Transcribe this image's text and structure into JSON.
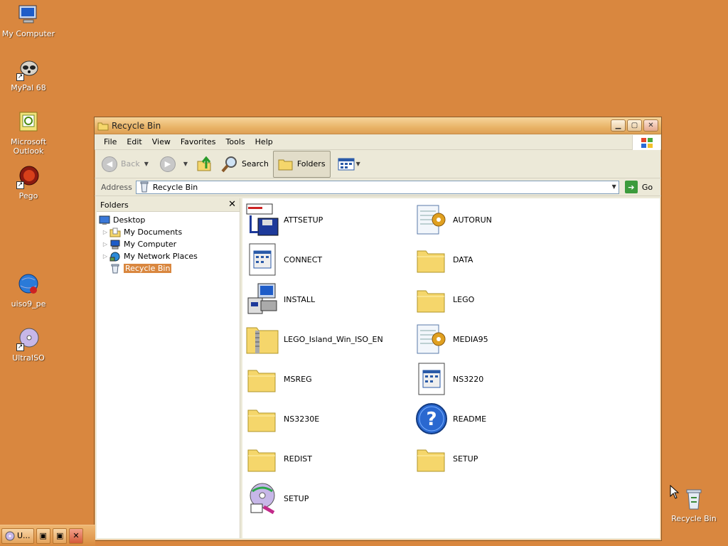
{
  "desktop": {
    "icons": [
      {
        "label": "My Computer",
        "icon": "my-computer-icon"
      },
      {
        "label": "MyPal 68",
        "icon": "raccoon-icon"
      },
      {
        "label": "Microsoft Outlook",
        "icon": "outlook-icon"
      },
      {
        "label": "Pego",
        "icon": "pego-icon"
      },
      {
        "label": "uiso9_pe",
        "icon": "globe-icon"
      },
      {
        "label": "UltraISO",
        "icon": "disc-icon"
      },
      {
        "label": "Recycle Bin",
        "icon": "recycle-bin-icon"
      }
    ]
  },
  "window": {
    "title": "Recycle Bin",
    "menu": [
      "File",
      "Edit",
      "View",
      "Favorites",
      "Tools",
      "Help"
    ],
    "toolbar": {
      "back": "Back",
      "search": "Search",
      "folders": "Folders"
    },
    "address": {
      "label": "Address",
      "value": "Recycle Bin",
      "go": "Go"
    },
    "folders_pane": {
      "header": "Folders",
      "tree": [
        {
          "label": "Desktop",
          "icon": "desktop-icon",
          "indent": 0,
          "expander": false
        },
        {
          "label": "My Documents",
          "icon": "my-documents-icon",
          "indent": 1,
          "expander": true
        },
        {
          "label": "My Computer",
          "icon": "my-computer-icon",
          "indent": 1,
          "expander": true
        },
        {
          "label": "My Network Places",
          "icon": "network-places-icon",
          "indent": 1,
          "expander": true
        },
        {
          "label": "Recycle Bin",
          "icon": "recycle-bin-icon",
          "indent": 1,
          "expander": false,
          "selected": true
        }
      ]
    },
    "files": [
      {
        "name": "ATTSETUP",
        "icon": "setup-floppy-icon"
      },
      {
        "name": "AUTORUN",
        "icon": "config-file-icon"
      },
      {
        "name": "CONNECT",
        "icon": "app-window-icon"
      },
      {
        "name": "DATA",
        "icon": "folder-icon"
      },
      {
        "name": "INSTALL",
        "icon": "installer-icon"
      },
      {
        "name": "LEGO",
        "icon": "folder-icon"
      },
      {
        "name": "LEGO_Island_Win_ISO_EN",
        "icon": "zip-folder-icon"
      },
      {
        "name": "MEDIA95",
        "icon": "config-file-icon"
      },
      {
        "name": "MSREG",
        "icon": "folder-icon"
      },
      {
        "name": "NS3220",
        "icon": "app-window-icon"
      },
      {
        "name": "NS3230E",
        "icon": "folder-icon"
      },
      {
        "name": "README",
        "icon": "help-icon"
      },
      {
        "name": "REDIST",
        "icon": "folder-icon"
      },
      {
        "name": "SETUP",
        "icon": "folder-icon"
      },
      {
        "name": "SETUP",
        "icon": "setup-cd-icon"
      }
    ]
  },
  "taskbar": {
    "buttons": [
      "U..."
    ]
  },
  "colors": {
    "desktop_bg": "#d9873f",
    "selection": "#d9873f",
    "folder_yellow": "#f5d66b"
  }
}
